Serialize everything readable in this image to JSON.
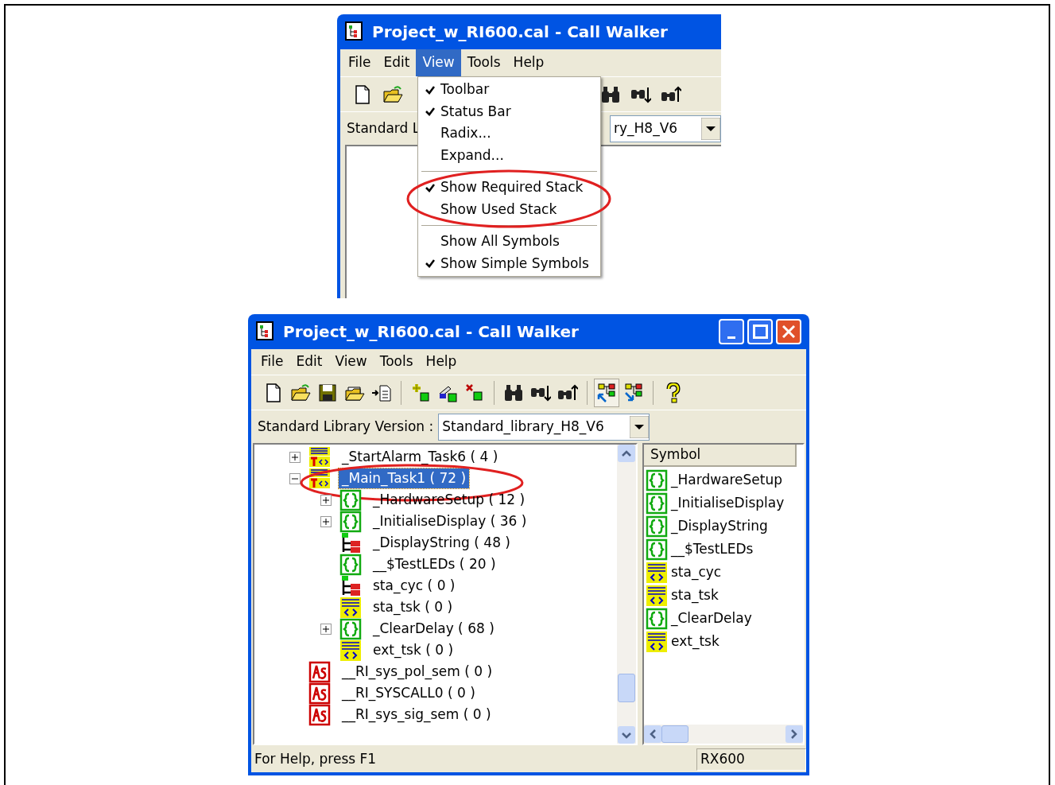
{
  "top_window": {
    "title": "Project_w_RI600.cal - Call Walker",
    "menu": [
      {
        "label": "File",
        "selected": false
      },
      {
        "label": "Edit",
        "selected": false
      },
      {
        "label": "View",
        "selected": true
      },
      {
        "label": "Tools",
        "selected": false
      },
      {
        "label": "Help",
        "selected": false
      }
    ],
    "library_label": "Standard L",
    "library_value": "ry_H8_V6",
    "view_menu": [
      {
        "circled": false,
        "items": [
          {
            "label": "Toolbar",
            "checked": true
          },
          {
            "label": "Status Bar",
            "checked": true
          },
          {
            "label": "Radix...",
            "checked": false
          },
          {
            "label": "Expand...",
            "checked": false
          }
        ]
      },
      {
        "circled": true,
        "items": [
          {
            "label": "Show Required Stack",
            "checked": true
          },
          {
            "label": "Show Used Stack",
            "checked": false
          }
        ]
      },
      {
        "circled": false,
        "items": [
          {
            "label": "Show All Symbols",
            "checked": false
          },
          {
            "label": "Show Simple Symbols",
            "checked": true
          }
        ]
      }
    ]
  },
  "main_window": {
    "title": "Project_w_RI600.cal - Call Walker",
    "menu": [
      "File",
      "Edit",
      "View",
      "Tools",
      "Help"
    ],
    "toolbar": [
      [
        {
          "pressed": false
        },
        {
          "pressed": false
        },
        {
          "pressed": false
        },
        {
          "pressed": false
        },
        {
          "pressed": false
        }
      ],
      [
        {
          "pressed": false
        },
        {
          "pressed": false
        },
        {
          "pressed": false
        }
      ],
      [
        {
          "pressed": false
        },
        {
          "pressed": false
        },
        {
          "pressed": false
        }
      ],
      [
        {
          "pressed": true
        },
        {
          "pressed": false
        }
      ],
      [
        {
          "pressed": false
        }
      ]
    ],
    "library_label": "Standard Library Version :",
    "library_value": "Standard_library_H8_V6",
    "tree": [
      {
        "label": "_StartAlarm_Task6  ( 4 )",
        "kind": "task",
        "has_children": true,
        "expanded": false,
        "selected": false,
        "circled": false
      },
      {
        "label": "_Main_Task1  ( 72 )",
        "kind": "task",
        "has_children": true,
        "expanded": true,
        "selected": true,
        "circled": true,
        "children": [
          {
            "label": "_HardwareSetup  ( 12 )",
            "kind": "function",
            "has_children": true,
            "expanded": false,
            "selected": false,
            "circled": false
          },
          {
            "label": "_InitialiseDisplay  ( 36 )",
            "kind": "function",
            "has_children": true,
            "expanded": false,
            "selected": false,
            "circled": false
          },
          {
            "label": "_DisplayString  ( 48 )",
            "kind": "service",
            "has_children": false,
            "selected": false,
            "circled": false
          },
          {
            "label": "__$TestLEDs  ( 20 )",
            "kind": "function",
            "has_children": false,
            "selected": false,
            "circled": false
          },
          {
            "label": "sta_cyc  ( 0 )",
            "kind": "service",
            "has_children": false,
            "selected": false,
            "circled": false
          },
          {
            "label": "sta_tsk  ( 0 )",
            "kind": "rtos",
            "has_children": false,
            "selected": false,
            "circled": false
          },
          {
            "label": "_ClearDelay  ( 68 )",
            "kind": "function",
            "has_children": true,
            "expanded": false,
            "selected": false,
            "circled": false
          },
          {
            "label": "ext_tsk  ( 0 )",
            "kind": "rtos",
            "has_children": false,
            "selected": false,
            "circled": false
          }
        ]
      },
      {
        "label": "__RI_sys_pol_sem  ( 0 )",
        "kind": "asm",
        "has_children": false,
        "selected": false,
        "circled": false
      },
      {
        "label": "__RI_SYSCALL0  ( 0 )",
        "kind": "asm",
        "has_children": false,
        "selected": false,
        "circled": false
      },
      {
        "label": "__RI_sys_sig_sem  ( 0 )",
        "kind": "asm",
        "has_children": false,
        "selected": false,
        "circled": false
      }
    ],
    "symbol_header": "Symbol",
    "symbols": [
      {
        "label": "_HardwareSetup",
        "kind": "function"
      },
      {
        "label": "_InitialiseDisplay",
        "kind": "function"
      },
      {
        "label": "_DisplayString",
        "kind": "function"
      },
      {
        "label": "__$TestLEDs",
        "kind": "function"
      },
      {
        "label": "sta_cyc",
        "kind": "rtos"
      },
      {
        "label": "sta_tsk",
        "kind": "rtos"
      },
      {
        "label": "_ClearDelay",
        "kind": "function"
      },
      {
        "label": "ext_tsk",
        "kind": "rtos"
      }
    ],
    "status_bar": [
      "For Help, press F1",
      "RX600"
    ]
  }
}
